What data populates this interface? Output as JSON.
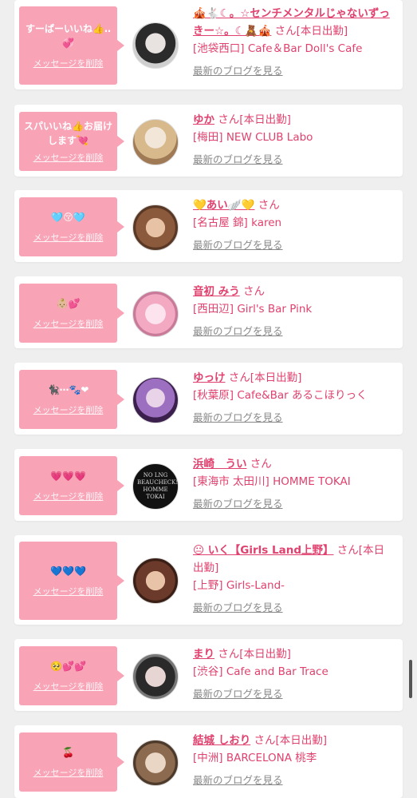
{
  "items": [
    {
      "message": "すーぱーいいね👍‥💞",
      "delete": "メッセージを削除",
      "name": "🎪🐇☾。☆センチメンタルじゃないずっきー☆。☾🧸🎪",
      "suffix": "さん[本日出勤]",
      "shop": "[池袋西口] Cafe＆Bar Doll's Cafe",
      "blog": "最新のブログを見る",
      "avatar_colors": [
        "#2b2b2b",
        "#cfcfcf"
      ]
    },
    {
      "message": "スパいいね👍お届けします💘",
      "delete": "メッセージを削除",
      "name": "ゆか",
      "suffix": "さん[本日出勤]",
      "shop": "[梅田] NEW CLUB Labo",
      "blog": "最新のブログを見る",
      "avatar_colors": [
        "#d7b98c",
        "#f2e6d8"
      ]
    },
    {
      "message": "🩵😚🩵",
      "delete": "メッセージを削除",
      "name": "💛あい🪽💛",
      "suffix": "さん",
      "shop": "[名古屋 錦] karen",
      "blog": "最新のブログを見る",
      "avatar_colors": [
        "#8b5a3c",
        "#e7c2a4"
      ]
    },
    {
      "message": "👶🏼💕",
      "delete": "メッセージを削除",
      "name": "音初 みう",
      "suffix": "さん",
      "shop": "[西田辺] Girl's Bar Pink",
      "blog": "最新のブログを見る",
      "avatar_colors": [
        "#f4a9c3",
        "#fde3ee"
      ]
    },
    {
      "message": "🐈‍⬛⋯🐾❤",
      "delete": "メッセージを削除",
      "name": "ゆっけ",
      "suffix": "さん[本日出勤]",
      "shop": "[秋葉原] Cafe&Bar あるこほりっく",
      "blog": "最新のブログを見る",
      "avatar_colors": [
        "#3b1f4d",
        "#9c6fc1"
      ]
    },
    {
      "message": "💗💗💗",
      "delete": "メッセージを削除",
      "name": "浜崎　うい",
      "suffix": "さん",
      "shop": "[東海市 太田川] HOMME TOKAI",
      "blog": "最新のブログを見る",
      "avatar_colors": [
        "#111111",
        "#6d6d6d"
      ],
      "avatar_text": "NO LNG BEAUCHECK! HOMME TOKAI"
    },
    {
      "message": "💙💙💙",
      "delete": "メッセージを削除",
      "name": "😐 いく【Girls Land上野】",
      "suffix": "さん[本日出勤]",
      "shop": "[上野] Girls-Land-",
      "blog": "最新のブログを見る",
      "avatar_colors": [
        "#6b3a2a",
        "#e8c3a7"
      ]
    },
    {
      "message": "🥺💕💕",
      "delete": "メッセージを削除",
      "name": "まり",
      "suffix": "さん[本日出勤]",
      "shop": "[渋谷] Cafe and Bar Trace",
      "blog": "最新のブログを見る",
      "avatar_colors": [
        "#2a2a2a",
        "#e6d5d2"
      ]
    },
    {
      "message": "🍒",
      "delete": "メッセージを削除",
      "name": "結城 しおり",
      "suffix": "さん[本日出勤]",
      "shop": "[中洲] BARCELONA 桃李",
      "blog": "最新のブログを見る",
      "avatar_colors": [
        "#8b6a4f",
        "#ead6c5"
      ]
    }
  ]
}
